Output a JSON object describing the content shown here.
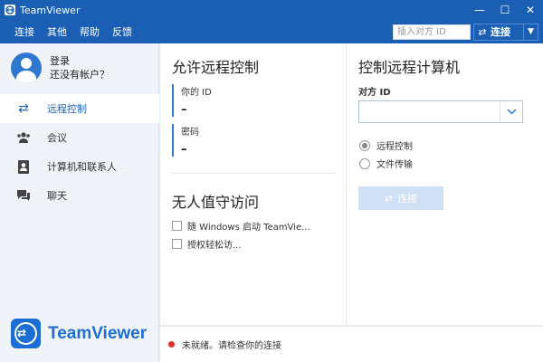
{
  "window": {
    "title": "TeamViewer",
    "controls": {
      "minimize": "—",
      "maximize": "☐",
      "close": "✕"
    }
  },
  "menubar": {
    "items": [
      "连接",
      "其他",
      "帮助",
      "反馈"
    ],
    "id_input_placeholder": "插入对方 ID",
    "connect_label": "连接"
  },
  "sidebar": {
    "profile": {
      "line1": "登录",
      "line2": "还没有帐户？"
    },
    "nav": [
      {
        "label": "远程控制",
        "icon": "arrows-icon",
        "active": true
      },
      {
        "label": "会议",
        "icon": "people-icon",
        "active": false
      },
      {
        "label": "计算机和联系人",
        "icon": "contacts-icon",
        "active": false
      },
      {
        "label": "聊天",
        "icon": "chat-icon",
        "active": false
      }
    ],
    "brand": "TeamViewer"
  },
  "allow_remote": {
    "title": "允许远程控制",
    "id_label": "你的 ID",
    "id_value": "–",
    "password_label": "密码",
    "password_value": "–"
  },
  "unattended": {
    "title": "无人值守访问",
    "options": [
      "随 Windows 启动 TeamVie...",
      "授权轻松访..."
    ]
  },
  "control_remote": {
    "title": "控制远程计算机",
    "partner_label": "对方 ID",
    "modes": [
      {
        "label": "远程控制",
        "selected": true
      },
      {
        "label": "文件传输",
        "selected": false
      }
    ],
    "connect_label": "连接"
  },
  "status": {
    "text": "未就绪。请检查你的连接",
    "color": "#e02f2f"
  },
  "colors": {
    "accent": "#1a5fb4",
    "brand": "#1c6ed5"
  }
}
